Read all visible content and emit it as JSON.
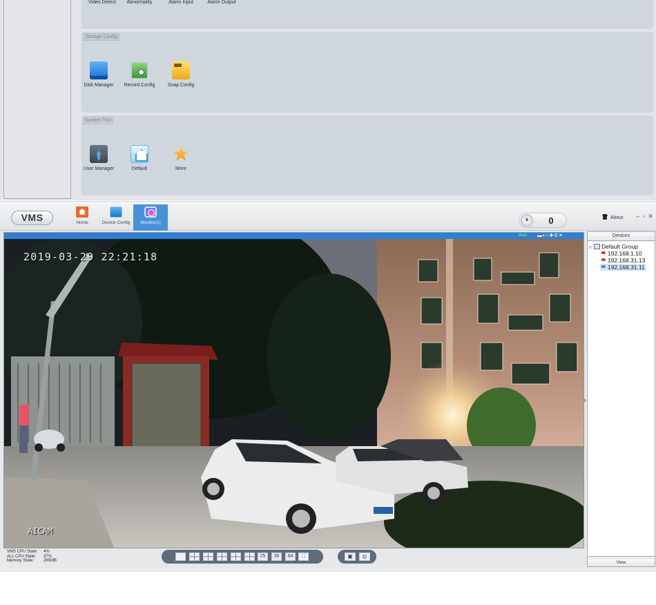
{
  "device_config": {
    "alarm_row": {
      "items": [
        "Video Detect",
        "Abnormality",
        "Alarm Input",
        "Alarm Output"
      ]
    },
    "storage": {
      "title": "Storage Config",
      "items": [
        {
          "label": "Disk Manager",
          "icon": "disk-manager-icon"
        },
        {
          "label": "Record Config",
          "icon": "record-config-icon"
        },
        {
          "label": "Snap Config",
          "icon": "snap-config-icon"
        }
      ]
    },
    "system": {
      "title": "System Tool",
      "items": [
        {
          "label": "User Manager",
          "icon": "user-manager-icon"
        },
        {
          "label": "Default",
          "icon": "default-icon"
        },
        {
          "label": "More",
          "icon": "more-star-icon"
        }
      ]
    }
  },
  "app": {
    "logo": "VMS",
    "nav": [
      {
        "label": "Home",
        "icon": "home-icon"
      },
      {
        "label": "Device Config",
        "icon": "device-config-icon"
      },
      {
        "label": "Monitor(1)",
        "icon": "monitor-icon",
        "active": true
      }
    ],
    "alarm_count": "0",
    "about": "About",
    "window_controls": "– ▫ ✕"
  },
  "video": {
    "status": "Auto",
    "toolbar_icons": [
      "record-icon",
      "snapshot-icon",
      "audio-icon",
      "ptz-icon",
      "talk-icon",
      "close-icon"
    ],
    "toolbar_glyphs": "▬▪∩✚✆✕",
    "osd_time": "2019-03-29 22:21:18",
    "osd_name": "AICAM"
  },
  "devices": {
    "title": "Devices",
    "group": "Default Group",
    "items": [
      {
        "ip": "192.168.1.10",
        "online": false
      },
      {
        "ip": "192.168.31.13",
        "online": false
      },
      {
        "ip": "192.168.31.11",
        "online": true,
        "selected": true
      }
    ],
    "view_button": "View"
  },
  "status": {
    "vms_cpu_label": "VMS CPU State:",
    "vms_cpu_value": "4%",
    "all_cpu_label": "ALL CPU State:",
    "all_cpu_value": "37%",
    "memory_label": "Memory State:",
    "memory_value": "265MB"
  },
  "layout_buttons": {
    "grid_icons": [
      "layout-1-icon",
      "layout-4-icon",
      "layout-6-icon",
      "layout-8-icon",
      "layout-9-icon",
      "layout-16-icon"
    ],
    "numbers": [
      "25",
      "36",
      "64"
    ],
    "fullscreen_icon": "fullscreen-icon",
    "save_icon": "save-layout-icon",
    "refresh_icon": "refresh-icon",
    "save_glyph": "▣",
    "refresh_glyph": "◎",
    "fullscreen_glyph": "⛶"
  },
  "colors": {
    "accent": "#4a90d9",
    "video_bar": "#2f7fd4",
    "status_green": "#7dff8a"
  }
}
